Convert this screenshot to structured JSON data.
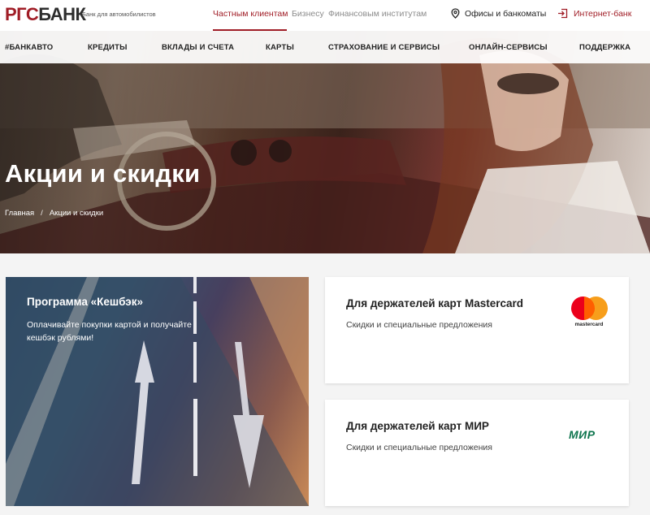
{
  "brand": {
    "logo_part1": "РГС",
    "logo_part2": "БАНК",
    "tagline": "Банк для автомобилистов",
    "accent_color": "#a01d26"
  },
  "segments": [
    "Частным клиентам",
    "Бизнесу",
    "Финансовым институтам"
  ],
  "active_segment": "Частным клиентам",
  "header_links": {
    "offices": "Офисы и банкоматы",
    "internet_bank": "Интернет-банк"
  },
  "nav": [
    "#БАНКАВТО",
    "КРЕДИТЫ",
    "ВКЛАДЫ И СЧЕТА",
    "КАРТЫ",
    "СТРАХОВАНИЕ И СЕРВИСЫ",
    "ОНЛАЙН-СЕРВИСЫ",
    "ПОДДЕРЖКА"
  ],
  "hero": {
    "title": "Акции и скидки",
    "breadcrumb": [
      "Главная",
      "/",
      "Акции и скидки"
    ]
  },
  "promo": {
    "title": "Программа «Кешбэк»",
    "text": "Оплачивайте покупки картой и получайте кешбэк рублями!"
  },
  "cards": [
    {
      "title": "Для держателей карт Mastercard",
      "subtitle": "Скидки и специальные предложения",
      "logo": "mastercard-logo",
      "logo_text": "mastercard"
    },
    {
      "title": "Для держателей карт МИР",
      "subtitle": "Скидки и специальные предложения",
      "logo": "mir-logo",
      "logo_text": "МИР"
    }
  ],
  "icons": {
    "offices": "location-pin-icon",
    "internet_bank": "login-icon"
  }
}
